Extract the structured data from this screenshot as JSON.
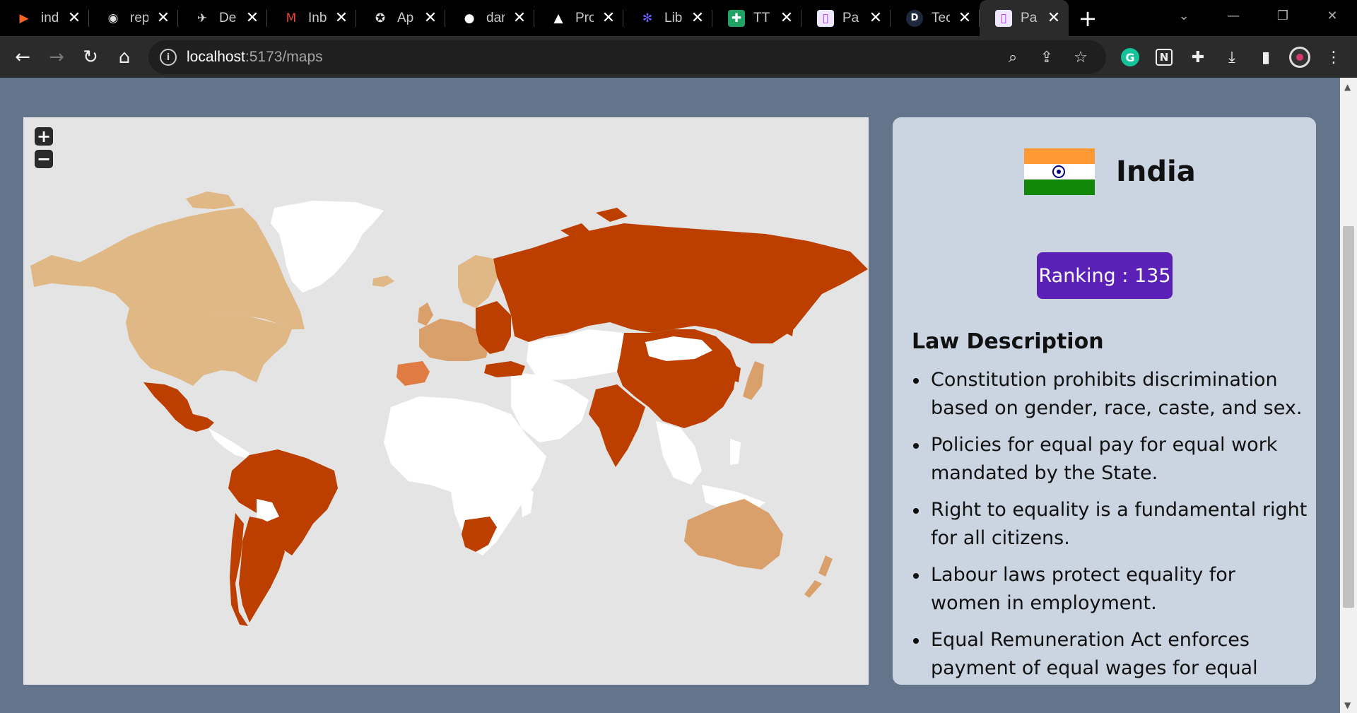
{
  "browser": {
    "tabs": [
      {
        "title": "ind",
        "icon": "orange-logo-icon",
        "icon_color": "#f26522"
      },
      {
        "title": "rep",
        "icon": "globe-icon",
        "icon_color": "#dddddd"
      },
      {
        "title": "De",
        "icon": "bird-icon",
        "icon_color": "#dddddd"
      },
      {
        "title": "Inb",
        "icon": "gmail-icon",
        "icon_color": "#ea4335"
      },
      {
        "title": "Ap",
        "icon": "star-badge-icon",
        "icon_color": "#dddddd"
      },
      {
        "title": "dar",
        "icon": "github-icon",
        "icon_color": "#ffffff"
      },
      {
        "title": "Pro",
        "icon": "triangle-icon",
        "icon_color": "#ffffff"
      },
      {
        "title": "Lib",
        "icon": "asterisk-icon",
        "icon_color": "#6a5cff"
      },
      {
        "title": "TT",
        "icon": "plus-square-icon",
        "icon_color": "#21a366"
      },
      {
        "title": "Pa",
        "icon": "vite-icon",
        "icon_color": "#bd34fe"
      },
      {
        "title": "Tec",
        "icon": "d-letter-icon",
        "icon_color": "#1e3a8a"
      },
      {
        "title": "Pa",
        "icon": "vite-icon",
        "icon_color": "#bd34fe",
        "active": true
      }
    ],
    "url_host": "localhost",
    "url_rest": ":5173/maps"
  },
  "map": {
    "zoom_in_label": "+",
    "zoom_out_label": "−",
    "colors": {
      "ocean": "#e4e4e4",
      "no_data": "#ffffff",
      "tier_high": "#dfb886",
      "tier_mid": "#d9a06b",
      "tier_low": "#e07b44",
      "tier_lowest": "#bc3f00"
    }
  },
  "panel": {
    "country": "India",
    "ranking_label": "Ranking : 135",
    "law_title": "Law Description",
    "laws": [
      "Constitution prohibits discrimination based on gender, race, caste, and sex.",
      "Policies for equal pay for equal work mandated by the State.",
      "Right to equality is a fundamental right for all citizens.",
      "Labour laws protect equality for women in employment.",
      "Equal Remuneration Act enforces payment of equal wages for equal work, with penalties for non-"
    ]
  }
}
